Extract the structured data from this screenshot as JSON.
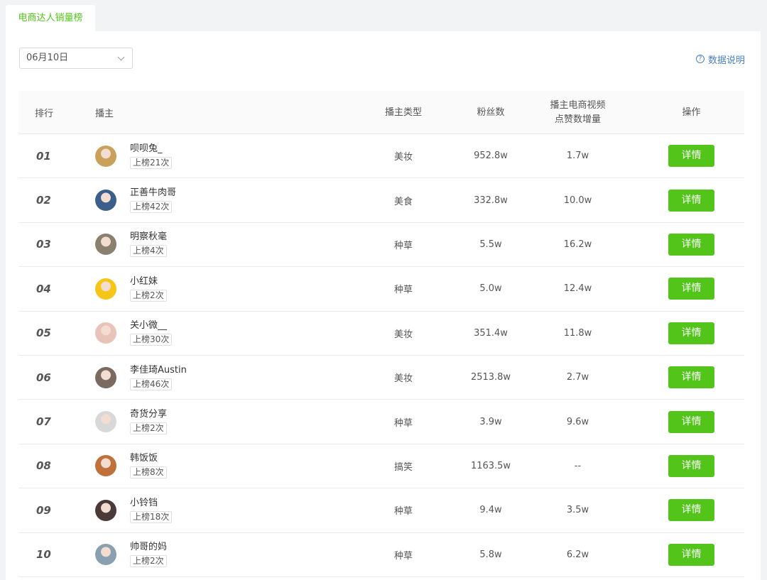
{
  "tab": {
    "label": "电商达人销量榜"
  },
  "date_select": {
    "value": "06月10日"
  },
  "data_explain": {
    "label": "数据说明"
  },
  "columns": {
    "rank": "排行",
    "streamer": "播主",
    "type": "播主类型",
    "fans": "粉丝数",
    "likes_line1": "播主电商视频",
    "likes_line2": "点赞数增量",
    "action": "操作"
  },
  "rows": [
    {
      "rank": "01",
      "name": "呗呗兔_",
      "times": "上榜21次",
      "type": "美妆",
      "fans": "952.8w",
      "likes": "1.7w",
      "action": "详情",
      "avatar_color": "#c9a15a"
    },
    {
      "rank": "02",
      "name": "正善牛肉哥",
      "times": "上榜42次",
      "type": "美食",
      "fans": "332.8w",
      "likes": "10.0w",
      "action": "详情",
      "avatar_color": "#3a5f8a"
    },
    {
      "rank": "03",
      "name": "明察秋毫",
      "times": "上榜4次",
      "type": "种草",
      "fans": "5.5w",
      "likes": "16.2w",
      "action": "详情",
      "avatar_color": "#8a8070"
    },
    {
      "rank": "04",
      "name": "小红妹",
      "times": "上榜2次",
      "type": "种草",
      "fans": "5.0w",
      "likes": "12.4w",
      "action": "详情",
      "avatar_color": "#f5c518"
    },
    {
      "rank": "05",
      "name": "关小微__",
      "times": "上榜30次",
      "type": "美妆",
      "fans": "351.4w",
      "likes": "11.8w",
      "action": "详情",
      "avatar_color": "#e8c4b8"
    },
    {
      "rank": "06",
      "name": "李佳琦Austin",
      "times": "上榜46次",
      "type": "美妆",
      "fans": "2513.8w",
      "likes": "2.7w",
      "action": "详情",
      "avatar_color": "#7a6a60"
    },
    {
      "rank": "07",
      "name": "奇货分享",
      "times": "上榜2次",
      "type": "种草",
      "fans": "3.9w",
      "likes": "9.6w",
      "action": "详情",
      "avatar_color": "#d8d8d8"
    },
    {
      "rank": "08",
      "name": "韩饭饭",
      "times": "上榜8次",
      "type": "搞笑",
      "fans": "1163.5w",
      "likes": "--",
      "action": "详情",
      "avatar_color": "#c0703a"
    },
    {
      "rank": "09",
      "name": "小铃铛",
      "times": "上榜18次",
      "type": "种草",
      "fans": "9.4w",
      "likes": "3.5w",
      "action": "详情",
      "avatar_color": "#4a3a38"
    },
    {
      "rank": "10",
      "name": "帅哥的妈",
      "times": "上榜2次",
      "type": "种草",
      "fans": "5.8w",
      "likes": "6.2w",
      "action": "详情",
      "avatar_color": "#8aa0b0"
    }
  ],
  "colors": {
    "accent": "#52c41a",
    "link": "#4a7fc1"
  }
}
